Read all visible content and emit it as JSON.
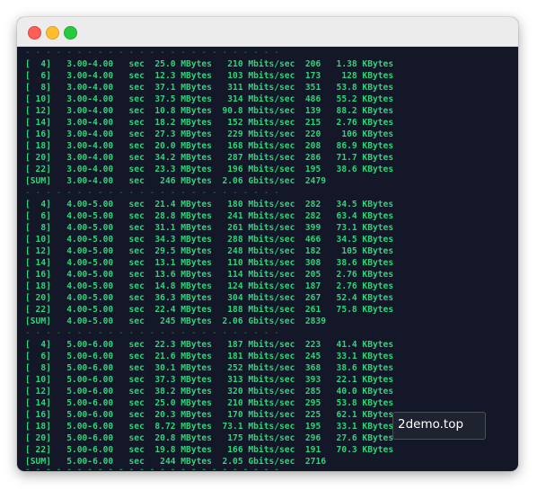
{
  "window": {
    "controls": [
      "close",
      "minimize",
      "maximize"
    ]
  },
  "terminal": {
    "lines": [
      {
        "kind": "sep",
        "text": "- - - - - - - - - - - - - - - - - - - - - - - - -"
      },
      {
        "kind": "row",
        "text": "[  4]   3.00-4.00   sec  25.0 MBytes   210 Mbits/sec  206   1.38 KBytes"
      },
      {
        "kind": "row",
        "text": "[  6]   3.00-4.00   sec  12.3 MBytes   103 Mbits/sec  173    128 KBytes"
      },
      {
        "kind": "row",
        "text": "[  8]   3.00-4.00   sec  37.1 MBytes   311 Mbits/sec  351   53.8 KBytes"
      },
      {
        "kind": "row",
        "text": "[ 10]   3.00-4.00   sec  37.5 MBytes   314 Mbits/sec  486   55.2 KBytes"
      },
      {
        "kind": "row",
        "text": "[ 12]   3.00-4.00   sec  10.8 MBytes  90.8 Mbits/sec  139   88.2 KBytes"
      },
      {
        "kind": "row",
        "text": "[ 14]   3.00-4.00   sec  18.2 MBytes   152 Mbits/sec  215   2.76 KBytes"
      },
      {
        "kind": "row",
        "text": "[ 16]   3.00-4.00   sec  27.3 MBytes   229 Mbits/sec  220    106 KBytes"
      },
      {
        "kind": "row",
        "text": "[ 18]   3.00-4.00   sec  20.0 MBytes   168 Mbits/sec  208   86.9 KBytes"
      },
      {
        "kind": "row",
        "text": "[ 20]   3.00-4.00   sec  34.2 MBytes   287 Mbits/sec  286   71.7 KBytes"
      },
      {
        "kind": "row",
        "text": "[ 22]   3.00-4.00   sec  23.3 MBytes   196 Mbits/sec  195   38.6 KBytes"
      },
      {
        "kind": "row",
        "text": "[SUM]   3.00-4.00   sec   246 MBytes  2.06 Gbits/sec  2479"
      },
      {
        "kind": "sep",
        "text": "- - - - - - - - - - - - - - - - - - - - - - - - -"
      },
      {
        "kind": "row",
        "text": "[  4]   4.00-5.00   sec  21.4 MBytes   180 Mbits/sec  282   34.5 KBytes"
      },
      {
        "kind": "row",
        "text": "[  6]   4.00-5.00   sec  28.8 MBytes   241 Mbits/sec  282   63.4 KBytes"
      },
      {
        "kind": "row",
        "text": "[  8]   4.00-5.00   sec  31.1 MBytes   261 Mbits/sec  399   73.1 KBytes"
      },
      {
        "kind": "row",
        "text": "[ 10]   4.00-5.00   sec  34.3 MBytes   288 Mbits/sec  466   34.5 KBytes"
      },
      {
        "kind": "row",
        "text": "[ 12]   4.00-5.00   sec  29.5 MBytes   248 Mbits/sec  182    105 KBytes"
      },
      {
        "kind": "row",
        "text": "[ 14]   4.00-5.00   sec  13.1 MBytes   110 Mbits/sec  308   38.6 KBytes"
      },
      {
        "kind": "row",
        "text": "[ 16]   4.00-5.00   sec  13.6 MBytes   114 Mbits/sec  205   2.76 KBytes"
      },
      {
        "kind": "row",
        "text": "[ 18]   4.00-5.00   sec  14.8 MBytes   124 Mbits/sec  187   2.76 KBytes"
      },
      {
        "kind": "row",
        "text": "[ 20]   4.00-5.00   sec  36.3 MBytes   304 Mbits/sec  267   52.4 KBytes"
      },
      {
        "kind": "row",
        "text": "[ 22]   4.00-5.00   sec  22.4 MBytes   188 Mbits/sec  261   75.8 KBytes"
      },
      {
        "kind": "row",
        "text": "[SUM]   4.00-5.00   sec   245 MBytes  2.06 Gbits/sec  2839"
      },
      {
        "kind": "sep",
        "text": "- - - - - - - - - - - - - - - - - - - - - - - - -"
      },
      {
        "kind": "row",
        "text": "[  4]   5.00-6.00   sec  22.3 MBytes   187 Mbits/sec  223   41.4 KBytes"
      },
      {
        "kind": "row",
        "text": "[  6]   5.00-6.00   sec  21.6 MBytes   181 Mbits/sec  245   33.1 KBytes"
      },
      {
        "kind": "row",
        "text": "[  8]   5.00-6.00   sec  30.1 MBytes   252 Mbits/sec  368   38.6 KBytes"
      },
      {
        "kind": "row",
        "text": "[ 10]   5.00-6.00   sec  37.3 MBytes   313 Mbits/sec  393   22.1 KBytes"
      },
      {
        "kind": "row",
        "text": "[ 12]   5.00-6.00   sec  38.2 MBytes   320 Mbits/sec  285   40.0 KBytes"
      },
      {
        "kind": "row",
        "text": "[ 14]   5.00-6.00   sec  25.0 MBytes   210 Mbits/sec  295   53.8 KBytes"
      },
      {
        "kind": "row",
        "text": "[ 16]   5.00-6.00   sec  20.3 MBytes   170 Mbits/sec  225   62.1 KBytes"
      },
      {
        "kind": "row",
        "text": "[ 18]   5.00-6.00   sec  8.72 MBytes  73.1 Mbits/sec  195   33.1 KBytes"
      },
      {
        "kind": "row",
        "text": "[ 20]   5.00-6.00   sec  20.8 MBytes   175 Mbits/sec  296   27.6 KBytes"
      },
      {
        "kind": "row",
        "text": "[ 22]   5.00-6.00   sec  19.8 MBytes   166 Mbits/sec  191   70.3 KBytes"
      },
      {
        "kind": "row",
        "text": "[SUM]   5.00-6.00   sec   244 MBytes  2.05 Gbits/sec  2716"
      },
      {
        "kind": "cut",
        "text": "- - - - - - - - - - - - - - - - - - - - - - - - -"
      }
    ]
  },
  "tooltip": {
    "text": "2demo.top"
  },
  "colors": {
    "terminal_bg": "#131727",
    "text_green": "#2fd37a",
    "separator_green": "#1f7f52",
    "titlebar": "#ececec"
  }
}
